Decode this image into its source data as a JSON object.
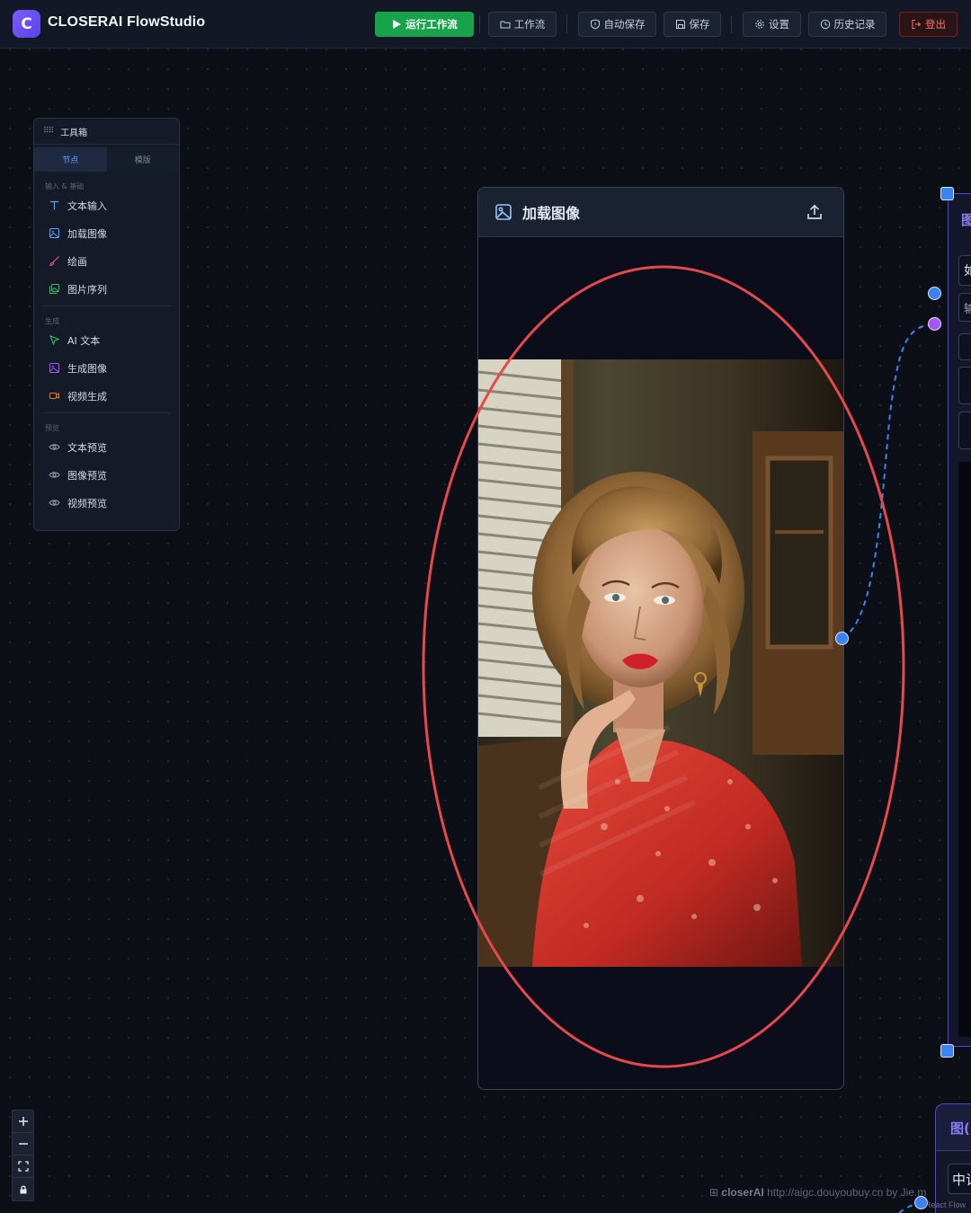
{
  "app": {
    "logo_letter": "C",
    "title": "CLOSERAI FlowStudio"
  },
  "toolbar": {
    "run_label": "运行工作流",
    "workflow_label": "工作流",
    "autosave_label": "自动保存",
    "save_label": "保存",
    "settings_label": "设置",
    "history_label": "历史记录",
    "logout_label": "登出"
  },
  "toolbox": {
    "title": "工具箱",
    "tabs": [
      "节点",
      "模版"
    ],
    "sections": [
      {
        "label": "输入 & 基础",
        "items": [
          "文本输入",
          "加载图像",
          "绘画",
          "图片序列"
        ]
      },
      {
        "label": "生成",
        "items": [
          "AI 文本",
          "生成图像",
          "视频生成"
        ]
      },
      {
        "label": "预览",
        "items": [
          "文本预览",
          "图像预览",
          "视频预览"
        ]
      }
    ]
  },
  "node": {
    "title": "加载图像"
  },
  "right_node": {
    "partial_labels": [
      "图",
      "如",
      "输"
    ]
  },
  "right_node2": {
    "partial_labels": [
      "图(",
      "中记"
    ]
  },
  "watermark": {
    "brand": "closerAI",
    "text": "http://aigc.douyoubuy.cn by Jie.m"
  },
  "react_flow_attribution": "React Flow",
  "colors": {
    "accent": "#3b82f6",
    "run_button": "#16a34a",
    "logout": "#f87171",
    "annotation_ring": "#e5484d",
    "purple_handle": "#a855f7"
  }
}
